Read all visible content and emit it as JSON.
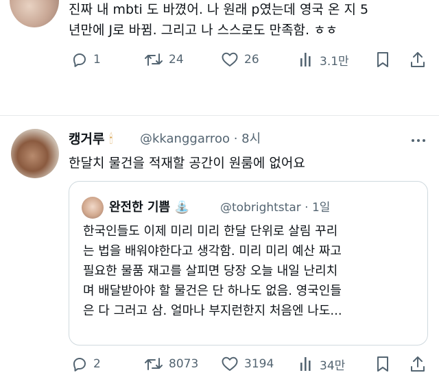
{
  "tweet1": {
    "text_lines": [
      "진짜 내 mbti 도 바꼈어. 나 원래 p였는데 영국 온 지 5",
      "년만에 J로 바뀜. 그리고 나 스스로도 만족함. ㅎㅎ"
    ],
    "actions": {
      "reply_count": "1",
      "retweet_count": "24",
      "like_count": "26",
      "view_count": "3.1만"
    }
  },
  "tweet2": {
    "author_name": "캥거루",
    "author_emoji": "🕯",
    "handle_time": "@kkanggarroo · 8시",
    "text": "한달치 물건을 적재할 공간이 원룸에 없어요",
    "quote": {
      "author_name": "완전한 기쁨",
      "author_emoji": "⛲",
      "handle_time": "@tobrightstar · 1일",
      "text_lines": [
        "한국인들도 이제 미리 미리 한달 단위로 살림 꾸리",
        "는 법을 배워야한다고 생각함. 미리 미리 예산 짜고",
        "필요한 물품 재고를 살피면 당장 오늘 내일 난리치",
        "며 배달받아야 할 물건은 단 하나도 없음. 영국인들",
        "은 다 그러고 삼. 얼마나 부지런한지 처음엔 나도..."
      ]
    },
    "actions": {
      "reply_count": "2",
      "retweet_count": "8073",
      "like_count": "3194",
      "view_count": "34만"
    }
  },
  "colors": {
    "text": "#0f1419",
    "secondary": "#536471",
    "border": "#cfd9de"
  },
  "icons": [
    "reply-icon",
    "retweet-icon",
    "like-icon",
    "views-icon",
    "bookmark-icon",
    "share-icon",
    "more-icon"
  ]
}
